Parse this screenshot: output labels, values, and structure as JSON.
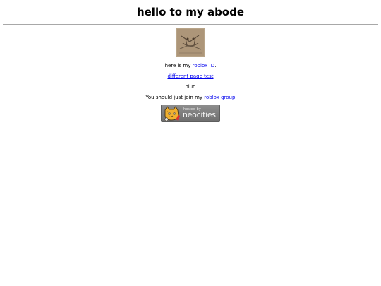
{
  "header": {
    "title": "hello to my abode"
  },
  "avatar": {
    "icon": "sketch-avatar-image"
  },
  "lines": {
    "line1_prefix": "here is my ",
    "line1_link": "roblox :D",
    "line1_suffix": ".",
    "line2_link": "different page test",
    "line3": "blud",
    "line4_prefix": "You should just join my ",
    "line4_link": "roblox group"
  },
  "badge": {
    "hosted_label": "hosted by",
    "brand_label": "neocities",
    "icon": "neocities-cat-icon"
  },
  "colors": {
    "link": "#0000ee",
    "badge": "#7a7a7a"
  }
}
